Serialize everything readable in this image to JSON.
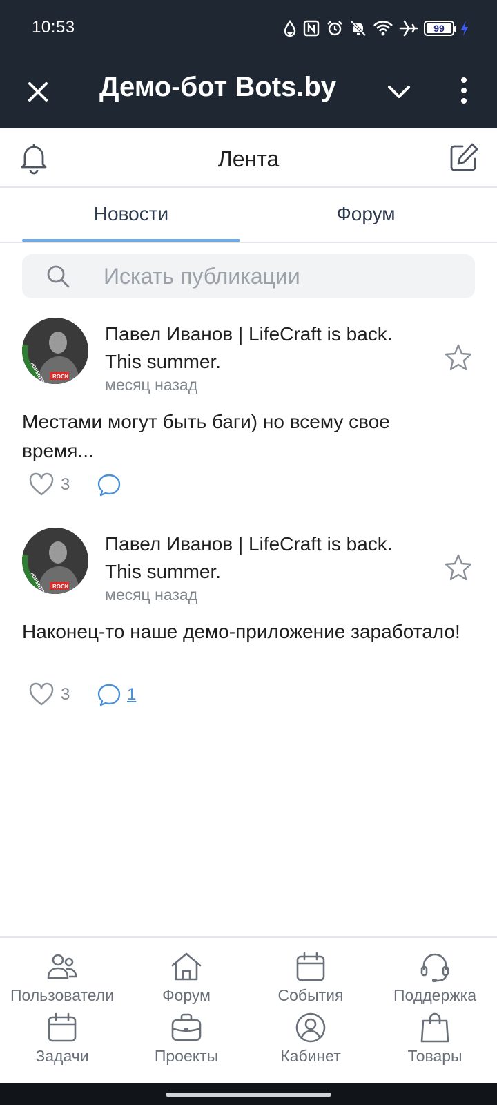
{
  "status_bar": {
    "time": "10:53",
    "battery": "99",
    "icons": [
      "drop-icon",
      "nfc-icon",
      "alarm-icon",
      "bell-off-icon",
      "wifi-icon",
      "airplane-icon",
      "battery-icon",
      "charging-icon"
    ]
  },
  "titlebar": {
    "title": "Демо-бот Bots.by",
    "background_color": "#1f2733"
  },
  "header": {
    "title": "Лента"
  },
  "tabs": [
    {
      "label": "Новости",
      "active": true
    },
    {
      "label": "Форум",
      "active": false
    }
  ],
  "search": {
    "placeholder": "Искать публикации",
    "value": ""
  },
  "posts": [
    {
      "author": "Павел Иванов | LifeCraft is back. This summer.",
      "time": "месяц назад",
      "text": "Местами могут быть баги) но всему свое время...",
      "likes": "3",
      "comments": ""
    },
    {
      "author": "Павел Иванов | LifeCraft is back. This summer.",
      "time": "месяц назад",
      "text": "Наконец-то наше демо-приложение заработало!",
      "likes": "3",
      "comments": "1"
    }
  ],
  "avatar": {
    "badge_left": "#OPENTO",
    "badge_right": "ROCK",
    "ring_color": "#2e7d32"
  },
  "bottom_nav": [
    {
      "label": "Пользователи",
      "icon": "users-icon"
    },
    {
      "label": "Форум",
      "icon": "home-icon"
    },
    {
      "label": "События",
      "icon": "calendar-icon"
    },
    {
      "label": "Поддержка",
      "icon": "headset-icon"
    },
    {
      "label": "Задачи",
      "icon": "calendar-icon"
    },
    {
      "label": "Проекты",
      "icon": "briefcase-icon"
    },
    {
      "label": "Кабинет",
      "icon": "user-circle-icon"
    },
    {
      "label": "Товары",
      "icon": "shopping-bag-icon"
    }
  ],
  "colors": {
    "accent": "#6fa8e6",
    "link": "#4a90d9",
    "muted": "#80868d"
  }
}
